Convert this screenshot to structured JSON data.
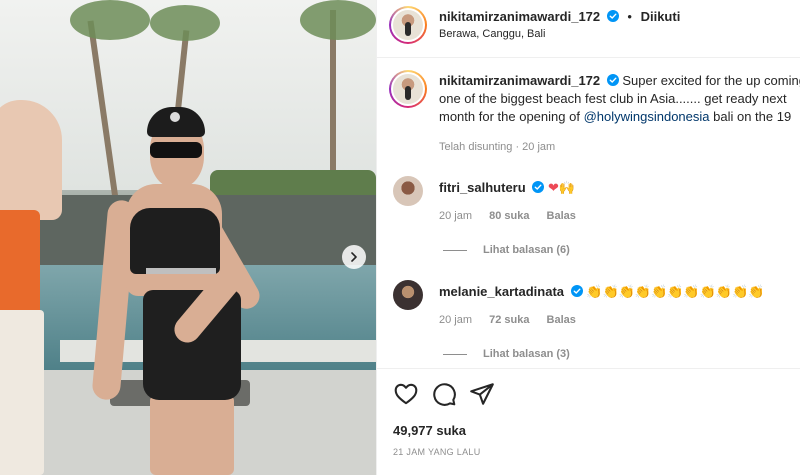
{
  "post": {
    "username": "nikitamirzanimawardi_172",
    "follow_status": "Diikuti",
    "location": "Berawa, Canggu, Bali",
    "caption_lines": [
      "Super excited for the up coming",
      "one of the biggest beach fest club in Asia....... get ready next",
      "month for the opening of"
    ],
    "caption_mention": "@holywingsindonesia",
    "caption_tail": "bali on the 19",
    "caption_meta": "Telah disunting · 20 jam",
    "likes": "49,977 suka",
    "time_ago": "21 JAM YANG LALU"
  },
  "comments": [
    {
      "username": "fitri_salhuteru",
      "text": "❤🙌",
      "time": "20 jam",
      "likes": "80 suka",
      "reply": "Balas",
      "view_replies": "Lihat balasan (6)"
    },
    {
      "username": "melanie_kartadinata",
      "text": "👏👏👏👏👏👏👏👏👏👏👏",
      "time": "20 jam",
      "likes": "72 suka",
      "reply": "Balas",
      "view_replies": "Lihat balasan (3)"
    }
  ],
  "colors": {
    "verified": "#0095f6",
    "mention": "#00376b",
    "heart": "#ed4956"
  },
  "icons": [
    "verified-icon",
    "next-arrow-icon",
    "heart-icon",
    "comment-icon",
    "share-icon"
  ]
}
